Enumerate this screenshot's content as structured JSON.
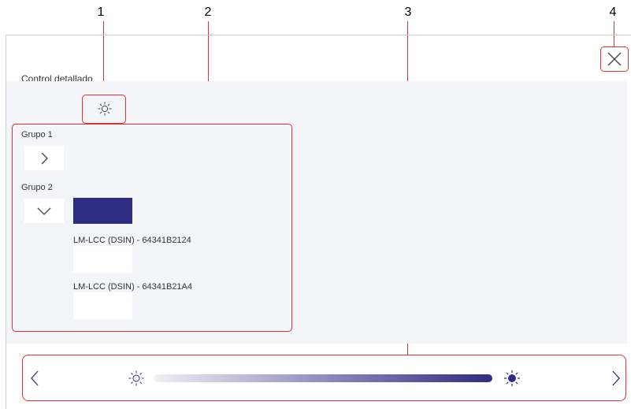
{
  "callouts": [
    "1",
    "2",
    "3",
    "4"
  ],
  "header": {
    "title": "Control detallado"
  },
  "groups": [
    {
      "label": "Grupo 1",
      "state": "collapsed"
    },
    {
      "label": "Grupo 2",
      "state": "expanded"
    }
  ],
  "group2": {
    "color": "#2e2c83",
    "devices": [
      {
        "label": "LM-LCC (DSIN) - 64341B2124"
      },
      {
        "label": "LM-LCC (DSIN) - 64341B21A4"
      }
    ]
  },
  "slider": {
    "min_icon": "sun-outline-icon",
    "max_icon": "sun-filled-icon",
    "color": "#2e2c83"
  },
  "icons": {
    "close": "close-icon",
    "brightness": "sun-icon",
    "prev": "chevron-left-icon",
    "next": "chevron-right-icon"
  },
  "colors": {
    "highlight": "#e03030",
    "accent": "#2e2c83",
    "panel_bg": "#f4f5f9"
  }
}
